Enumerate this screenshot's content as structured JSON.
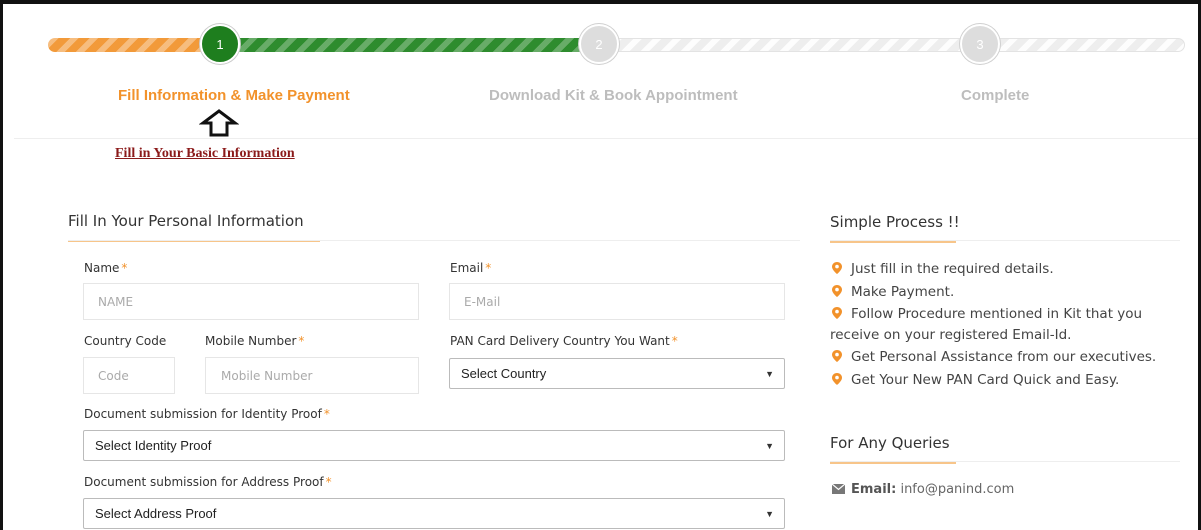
{
  "progress": {
    "steps": [
      {
        "number": "1",
        "label": "Fill Information & Make Payment",
        "state": "active"
      },
      {
        "number": "2",
        "label": "Download Kit & Book Appointment",
        "state": "pending"
      },
      {
        "number": "3",
        "label": "Complete",
        "state": "pending"
      }
    ],
    "hint": "Fill in Your Basic Information"
  },
  "form": {
    "heading": "Fill In Your Personal Information",
    "required_mark": "*",
    "name": {
      "label": "Name",
      "placeholder": "NAME"
    },
    "email": {
      "label": "Email",
      "placeholder": "E-Mail"
    },
    "country_code": {
      "label": "Country Code",
      "placeholder": "Code"
    },
    "mobile": {
      "label": "Mobile Number",
      "placeholder": "Mobile Number"
    },
    "delivery_country": {
      "label": "PAN Card Delivery Country You Want",
      "selected": "Select Country"
    },
    "identity_proof": {
      "label": "Document submission for Identity Proof",
      "selected": "Select Identity Proof"
    },
    "address_proof": {
      "label": "Document submission for Address Proof",
      "selected": "Select Address Proof"
    }
  },
  "process": {
    "heading": "Simple Process !!",
    "items": [
      "Just fill in the required details.",
      "Make Payment.",
      "Follow Procedure mentioned in Kit that you receive on your registered Email-Id.",
      "Get Personal Assistance from our executives.",
      "Get Your New PAN Card Quick and Easy."
    ]
  },
  "queries": {
    "heading": "For Any Queries",
    "email_label": "Email:",
    "email_value": "info@panind.com"
  },
  "colors": {
    "accent": "#f2922b",
    "active_step": "#1e7e1e",
    "hint_link": "#8b1a1a"
  }
}
